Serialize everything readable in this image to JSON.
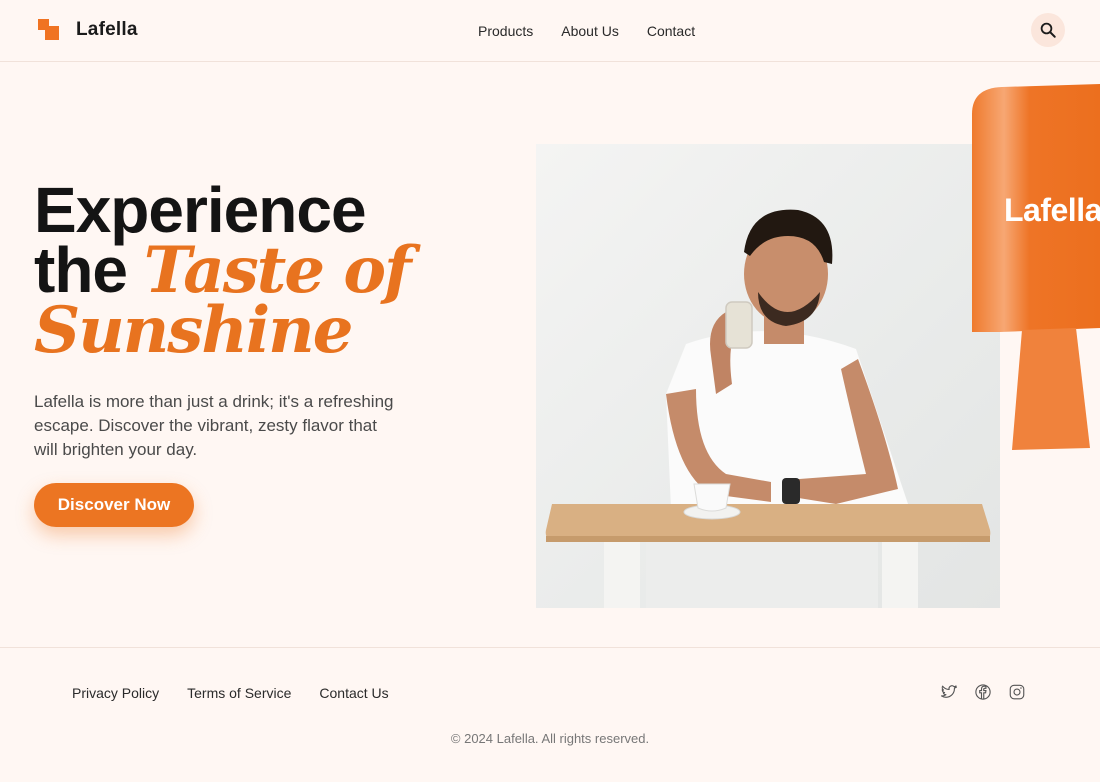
{
  "header": {
    "brand": "Lafella",
    "nav": [
      "Products",
      "About Us",
      "Contact"
    ],
    "search_icon": "search-icon"
  },
  "hero": {
    "headline_line1": "Experience",
    "headline_line2_plain": "the",
    "headline_line2_script": "Taste of",
    "headline_line3_script": "Sunshine",
    "description": "Lafella is more than just a drink; it's a refreshing escape. Discover the vibrant, zesty flavor that will brighten your day.",
    "cta_label": "Discover Now",
    "bottle_label": "Lafella"
  },
  "footer": {
    "links": [
      "Privacy Policy",
      "Terms of Service",
      "Contact Us"
    ],
    "social_icons": [
      "twitter-icon",
      "facebook-icon",
      "instagram-icon"
    ],
    "copyright": "© 2024 Lafella. All rights reserved."
  },
  "colors": {
    "accent": "#ec7522",
    "background": "#fff7f3"
  }
}
